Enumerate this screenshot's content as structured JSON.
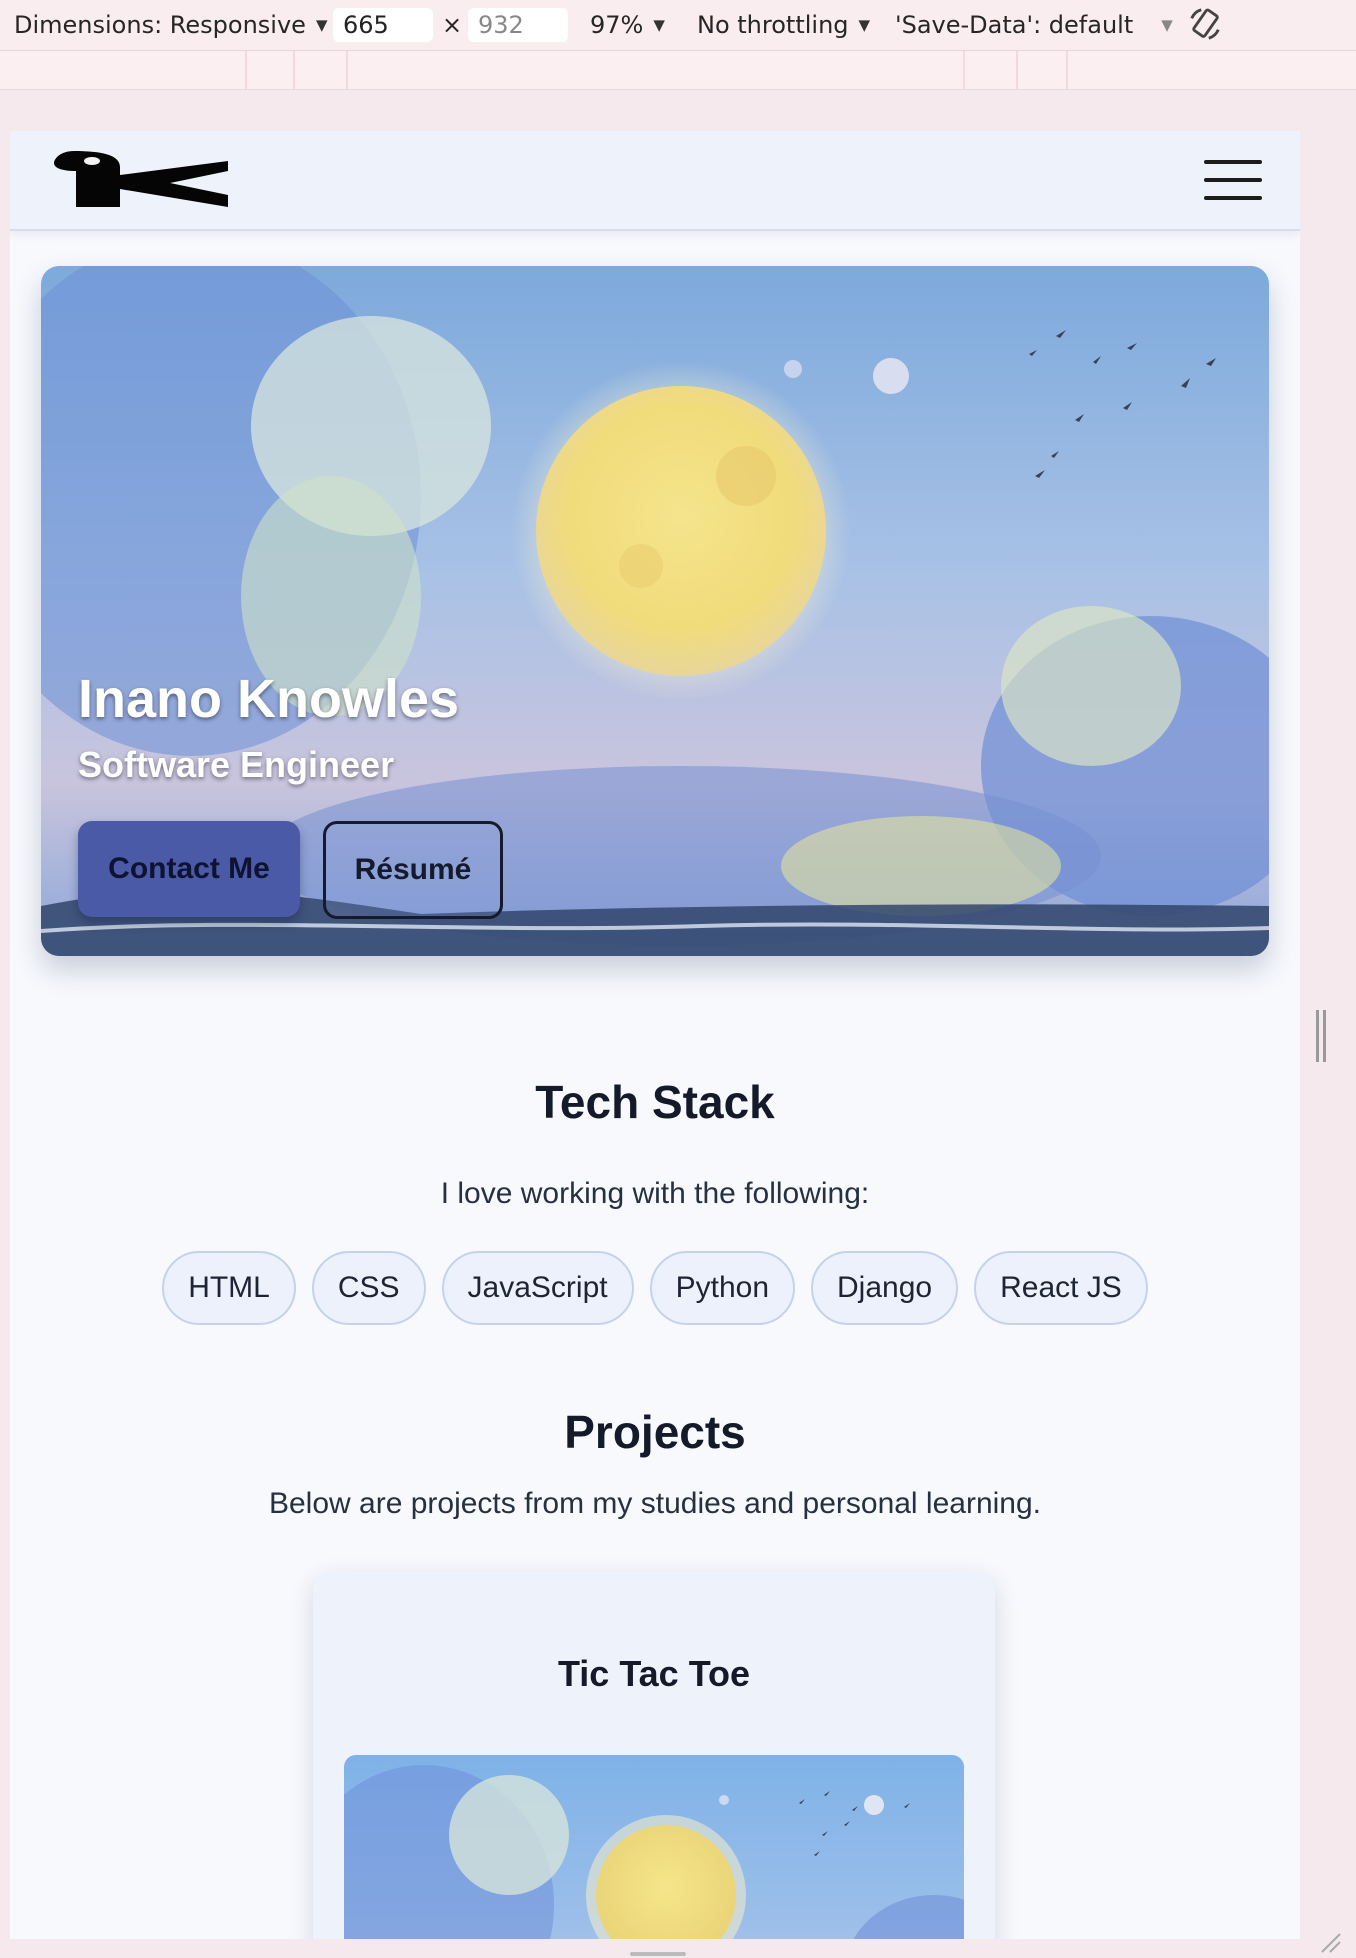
{
  "devtools": {
    "dimensions_label": "Dimensions: Responsive",
    "width_value": "665",
    "height_placeholder": "932",
    "times_symbol": "×",
    "zoom": "97%",
    "throttling": "No throttling",
    "save_data": "'Save-Data': default"
  },
  "site": {
    "hero": {
      "name": "Inano Knowles",
      "role": "Software Engineer",
      "contact_label": "Contact Me",
      "resume_label": "Résumé"
    },
    "tech": {
      "title": "Tech Stack",
      "subtitle": "I love working with the following:",
      "items": [
        "HTML",
        "CSS",
        "JavaScript",
        "Python",
        "Django",
        "React JS"
      ]
    },
    "projects": {
      "title": "Projects",
      "subtitle": "Below are projects from my studies and personal learning.",
      "cards": [
        {
          "title": "Tic Tac Toe"
        }
      ]
    }
  }
}
